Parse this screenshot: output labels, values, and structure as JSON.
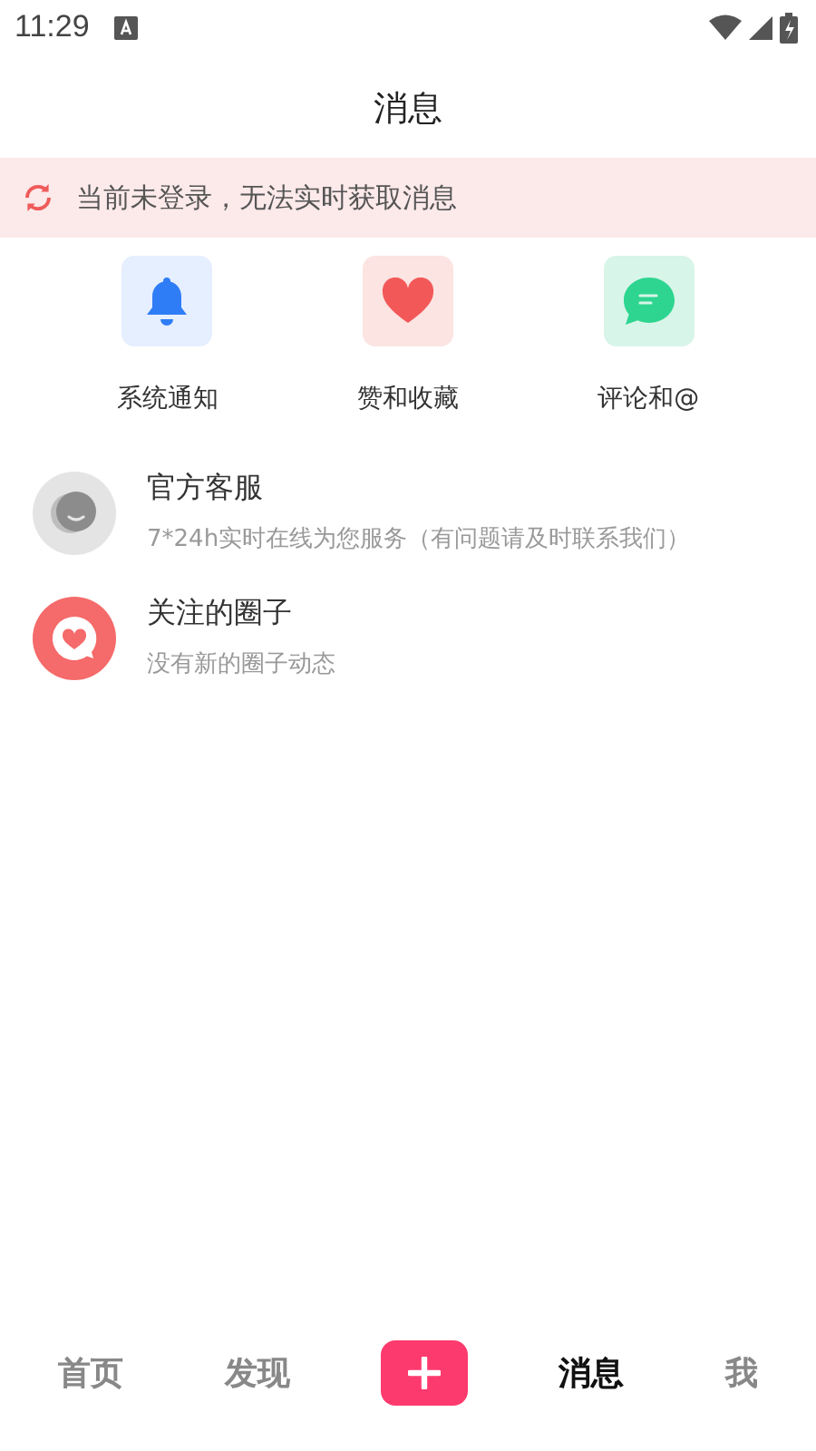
{
  "status_bar": {
    "time": "11:29"
  },
  "title": "消息",
  "notice": {
    "text": "当前未登录，无法实时获取消息"
  },
  "shortcuts": [
    {
      "kind": "bell",
      "label": "系统通知"
    },
    {
      "kind": "heart",
      "label": "赞和收藏"
    },
    {
      "kind": "comment",
      "label": "评论和@"
    }
  ],
  "conversations": [
    {
      "kind": "service",
      "name": "官方客服",
      "preview": "7*24h实时在线为您服务（有问题请及时联系我们）"
    },
    {
      "kind": "circle",
      "name": "关注的圈子",
      "preview": "没有新的圈子动态"
    }
  ],
  "tabs": [
    {
      "kind": "text",
      "label": "首页",
      "selected": false
    },
    {
      "kind": "text",
      "label": "发现",
      "selected": false
    },
    {
      "kind": "add",
      "selected": false
    },
    {
      "kind": "text",
      "label": "消息",
      "selected": true
    },
    {
      "kind": "text",
      "label": "我",
      "selected": false
    }
  ]
}
